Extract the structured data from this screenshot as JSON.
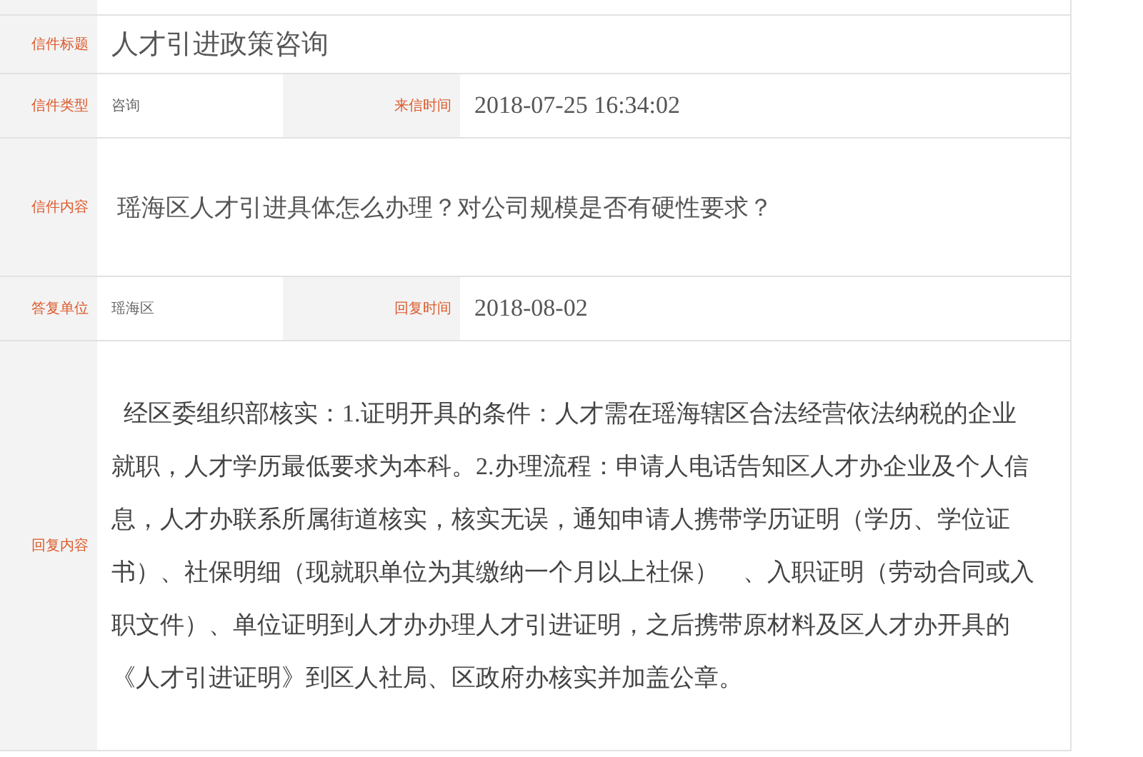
{
  "rows": [
    {
      "kind": "title",
      "label": "信件标题",
      "value": "人才引进政策咨询"
    },
    {
      "kind": "split",
      "label": "信件类型",
      "value": "咨询",
      "label2": "来信时间",
      "value2": "2018-07-25 16:34:02"
    },
    {
      "kind": "question",
      "label": "信件内容",
      "value": "瑶海区人才引进具体怎么办理？对公司规模是否有硬性要求？"
    },
    {
      "kind": "split",
      "label": "答复单位",
      "value": "瑶海区",
      "label2": "回复时间",
      "value2": "2018-08-02"
    },
    {
      "kind": "reply",
      "label": "回复内容",
      "value": "经区委组织部核实：1.证明开具的条件：人才需在瑶海辖区合法经营依法纳税的企业就职，人才学历最低要求为本科。2.办理流程：申请人电话告知区人才办企业及个人信息，人才办联系所属街道核实，核实无误，通知申请人携带学历证明（学历、学位证书）、社保明细（现就职单位为其缴纳一个月以上社保）　、入职证明（劳动合同或入职文件）、单位证明到人才办办理人才引进证明，之后携带原材料及区人才办开具的《人才引进证明》到区人社局、区政府办核实并加盖公章。"
    }
  ]
}
